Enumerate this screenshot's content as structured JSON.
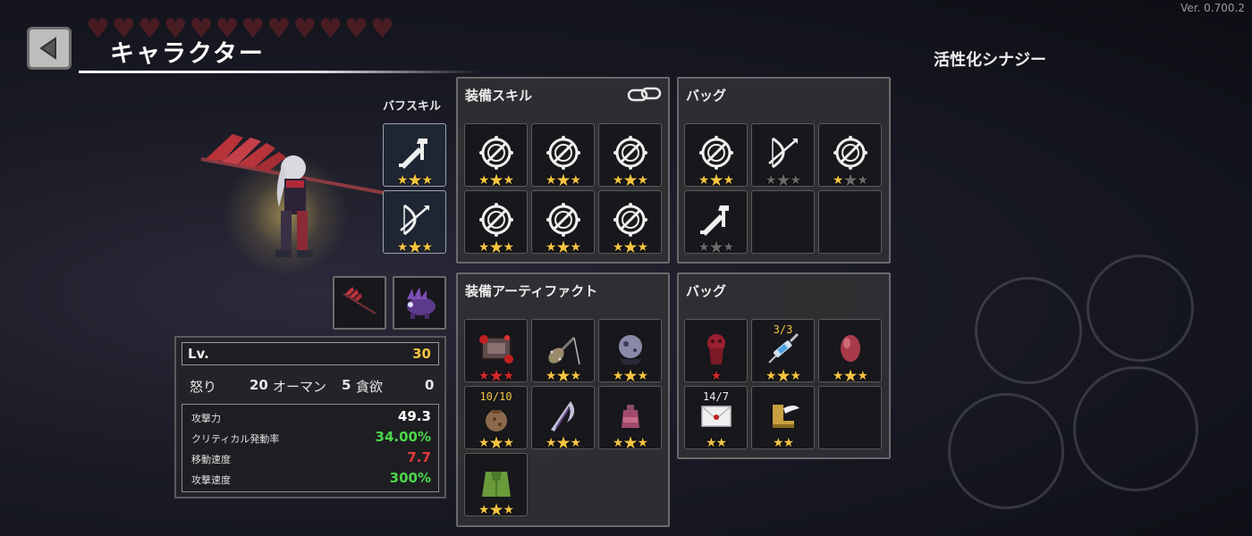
{
  "version": "Ver. 0.700.2",
  "header": {
    "title": "キャラクター",
    "back_icon": "back-arrow-icon"
  },
  "synergy": {
    "title": "活性化シナジー"
  },
  "buff_skills": {
    "label": "バフスキル",
    "slots": [
      {
        "icon": "sword-up-icon",
        "stars": [
          "gold",
          "gold",
          "gold"
        ]
      },
      {
        "icon": "bow-icon",
        "stars": [
          "gold",
          "gold",
          "gold"
        ]
      }
    ]
  },
  "equipped_skills": {
    "title": "装備スキル",
    "link_icon": "link-icon",
    "slots": [
      {
        "icon": "forbidden-shield-icon",
        "stars": [
          "gold",
          "gold",
          "gold"
        ]
      },
      {
        "icon": "forbidden-shield-icon",
        "stars": [
          "gold",
          "gold",
          "gold"
        ]
      },
      {
        "icon": "forbidden-shield-icon",
        "stars": [
          "gold",
          "gold",
          "gold"
        ]
      },
      {
        "icon": "forbidden-shield-icon",
        "stars": [
          "gold",
          "gold",
          "gold"
        ]
      },
      {
        "icon": "forbidden-shield-icon",
        "stars": [
          "gold",
          "gold",
          "gold"
        ]
      },
      {
        "icon": "forbidden-shield-icon",
        "stars": [
          "gold",
          "gold",
          "gold"
        ]
      }
    ]
  },
  "skill_bag": {
    "title": "バッグ",
    "slots": [
      {
        "icon": "forbidden-shield-icon",
        "stars": [
          "gold",
          "gold",
          "gold"
        ]
      },
      {
        "icon": "bow-icon",
        "stars": [
          "gray",
          "gray",
          "gray"
        ]
      },
      {
        "icon": "forbidden-shield-icon",
        "stars": [
          "gold",
          "gray",
          "gray"
        ]
      },
      {
        "icon": "sword-up-icon",
        "stars": [
          "gray",
          "gray",
          "gray"
        ]
      },
      {
        "icon": "",
        "stars": []
      },
      {
        "icon": "",
        "stars": []
      }
    ]
  },
  "equipped_artifacts": {
    "title": "装備アーティファクト",
    "slots": [
      {
        "icon": "burning-tome-icon",
        "stars": [
          "red",
          "red",
          "red"
        ],
        "count": ""
      },
      {
        "icon": "spiked-club-icon",
        "stars": [
          "gold",
          "gold",
          "gold"
        ],
        "count": ""
      },
      {
        "icon": "moon-orb-icon",
        "stars": [
          "gold",
          "gold",
          "gold"
        ],
        "count": ""
      },
      {
        "icon": "pouch-icon",
        "stars": [
          "gold",
          "gold",
          "gold"
        ],
        "count": "10/10"
      },
      {
        "icon": "scythe-blade-icon",
        "stars": [
          "gold",
          "gold",
          "gold"
        ],
        "count": ""
      },
      {
        "icon": "potion-flask-icon",
        "stars": [
          "gold",
          "gold",
          "gold"
        ],
        "count": ""
      },
      {
        "icon": "green-cloak-icon",
        "stars": [
          "gold",
          "gold",
          "gold"
        ],
        "count": ""
      }
    ]
  },
  "artifact_bag": {
    "title": "バッグ",
    "slots": [
      {
        "icon": "blood-idol-icon",
        "stars": [
          "red"
        ],
        "count": ""
      },
      {
        "icon": "syringe-icon",
        "stars": [
          "gold",
          "gold",
          "gold"
        ],
        "count": "3/3"
      },
      {
        "icon": "red-egg-icon",
        "stars": [
          "gold",
          "gold",
          "gold"
        ],
        "count": ""
      },
      {
        "icon": "letter-icon",
        "stars": [
          "gold",
          "gold"
        ],
        "count": "14/7"
      },
      {
        "icon": "winged-boot-icon",
        "stars": [
          "gold",
          "gold"
        ],
        "count": ""
      },
      {
        "icon": "",
        "stars": [],
        "count": ""
      }
    ]
  },
  "weapons": [
    {
      "icon": "spear-weapon-icon"
    },
    {
      "icon": "beast-pet-icon"
    }
  ],
  "stats": {
    "level_label": "Lv.",
    "level": "30",
    "traits": [
      {
        "label": "怒り",
        "value": "20"
      },
      {
        "label": "オーマン",
        "value": "5"
      },
      {
        "label": "貪欲",
        "value": "0"
      }
    ],
    "lines": [
      {
        "label": "攻撃力",
        "value": "49.3",
        "color": "#ffffff"
      },
      {
        "label": "クリティカル発動率",
        "value": "34.00%",
        "color": "#4cd94c"
      },
      {
        "label": "移動速度",
        "value": "7.7",
        "color": "#e53a3a"
      },
      {
        "label": "攻撃速度",
        "value": "300%",
        "color": "#4cd94c"
      }
    ]
  },
  "colors": {
    "star_gold": "#f5c542",
    "star_gray": "#6a6a6a",
    "star_red": "#d42a2a",
    "count_yellow": "#f3c340"
  }
}
